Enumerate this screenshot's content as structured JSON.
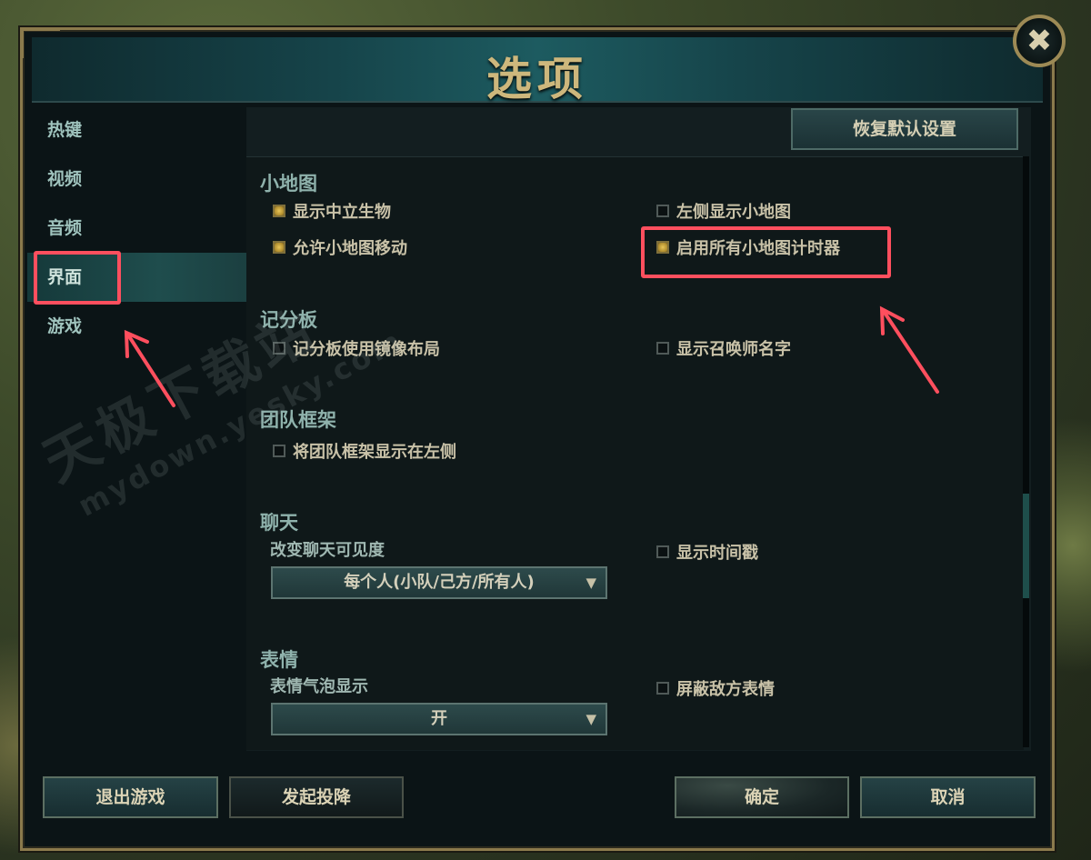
{
  "window": {
    "title": "选项",
    "close_icon": "✖"
  },
  "sidebar": {
    "items": [
      {
        "label": "热键",
        "active": false
      },
      {
        "label": "视频",
        "active": false
      },
      {
        "label": "音频",
        "active": false
      },
      {
        "label": "界面",
        "active": true
      },
      {
        "label": "游戏",
        "active": false
      }
    ]
  },
  "panel": {
    "reset_label": "恢复默认设置",
    "sections": {
      "minimap": {
        "title": "小地图",
        "show_neutral": {
          "label": "显示中立生物",
          "checked": true
        },
        "allow_move": {
          "label": "允许小地图移动",
          "checked": true
        },
        "left_side": {
          "label": "左侧显示小地图",
          "checked": false
        },
        "timers": {
          "label": "启用所有小地图计时器",
          "checked": true
        }
      },
      "scoreboard": {
        "title": "记分板",
        "mirror": {
          "label": "记分板使用镜像布局",
          "checked": false
        },
        "summoner_names": {
          "label": "显示召唤师名字",
          "checked": false
        }
      },
      "team_frames": {
        "title": "团队框架",
        "left": {
          "label": "将团队框架显示在左侧",
          "checked": false
        }
      },
      "chat": {
        "title": "聊天",
        "visibility_label": "改变聊天可见度",
        "visibility_value": "每个人(小队/己方/所有人)",
        "timestamps": {
          "label": "显示时间戳",
          "checked": false
        }
      },
      "emotes": {
        "title": "表情",
        "bubble_label": "表情气泡显示",
        "bubble_value": "开",
        "block_enemy": {
          "label": "屏蔽敌方表情",
          "checked": false
        }
      }
    }
  },
  "footer": {
    "exit_label": "退出游戏",
    "surrender_label": "发起投降",
    "confirm_label": "确定",
    "cancel_label": "取消"
  },
  "watermark": {
    "line1": "天极下载站",
    "line2": "mydown.yesky.com"
  },
  "colors": {
    "highlight": "#ff4f5e",
    "gold": "#cdb77c",
    "teal_text": "#8fb2ac"
  }
}
